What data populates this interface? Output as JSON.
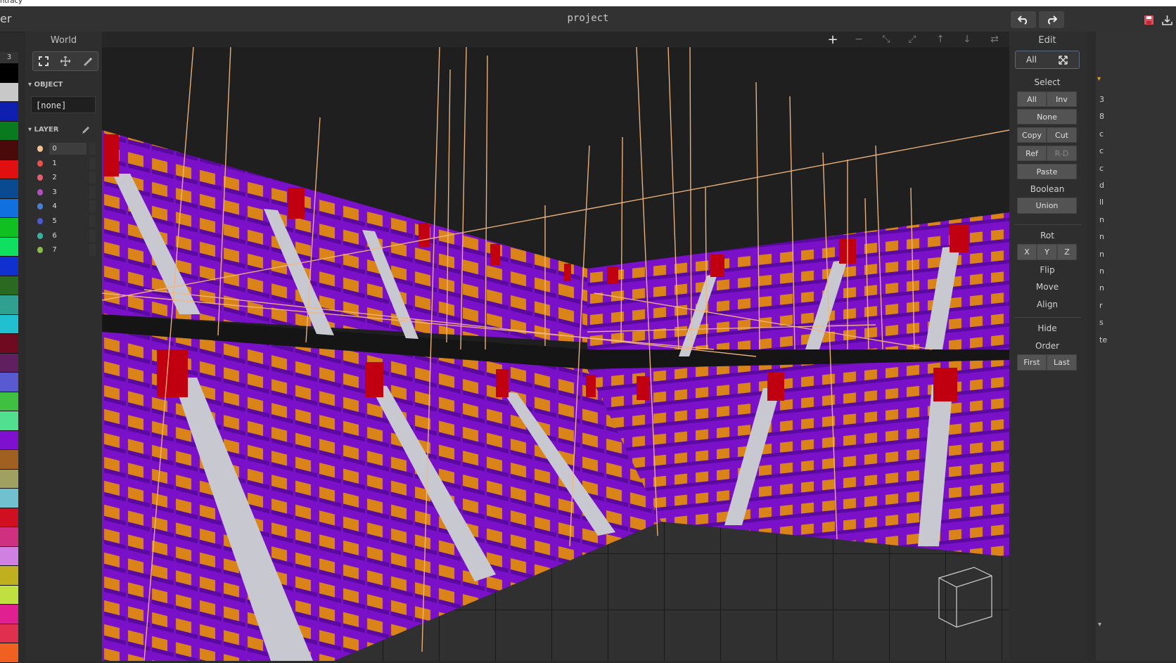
{
  "window": {
    "top_fragment": "ntracy",
    "left_fragment": "er",
    "title": "project"
  },
  "titlebar": {
    "undo_icon": "undo-icon",
    "redo_icon": "redo-icon",
    "save_icon": "save-icon",
    "export_icon": "export-icon"
  },
  "palette": {
    "index": "3",
    "colors": [
      "#000000",
      "#c8c8c8",
      "#0f1fb0",
      "#0a7a1e",
      "#4a0a0a",
      "#e01010",
      "#0a4a90",
      "#1070e0",
      "#10c020",
      "#10e060",
      "#1030d0",
      "#2a6a20",
      "#30a090",
      "#20c0d0",
      "#700a20",
      "#602060",
      "#5a5ad0",
      "#40c040",
      "#50e090",
      "#8010d0",
      "#a06020",
      "#a0a060",
      "#70c0d0",
      "#d01020",
      "#d03080",
      "#d080e0",
      "#c0b020",
      "#c0e040",
      "#e02090",
      "#e03050",
      "#f06020"
    ]
  },
  "left_panel": {
    "header": "World",
    "tools": {
      "select": "select-frame-icon",
      "move": "move-icon",
      "paint": "paint-icon"
    },
    "object_section": "OBJECT",
    "object_value": "[none]",
    "layer_section": "LAYER",
    "layers": [
      {
        "label": "0",
        "color": "#f3c18f"
      },
      {
        "label": "1",
        "color": "#e8504a"
      },
      {
        "label": "2",
        "color": "#e06070"
      },
      {
        "label": "3",
        "color": "#b050c0"
      },
      {
        "label": "4",
        "color": "#4a7fd0"
      },
      {
        "label": "5",
        "color": "#4a5ad0"
      },
      {
        "label": "6",
        "color": "#3ab0a0"
      },
      {
        "label": "7",
        "color": "#8cba4a"
      }
    ]
  },
  "viewport": {
    "toolbar": [
      "+",
      "−",
      "⤡",
      "⤢",
      "↑",
      "↓",
      "⇄"
    ]
  },
  "right_panel": {
    "header": "Edit",
    "all_label": "All",
    "select_heading": "Select",
    "select_all": "All",
    "select_inv": "Inv",
    "select_none": "None",
    "copy": "Copy",
    "cut": "Cut",
    "ref": "Ref",
    "rd": "R-D",
    "paste": "Paste",
    "boolean_heading": "Boolean",
    "union": "Union",
    "rot_heading": "Rot",
    "rot_x": "X",
    "rot_y": "Y",
    "rot_z": "Z",
    "flip": "Flip",
    "move": "Move",
    "align": "Align",
    "hide": "Hide",
    "order_heading": "Order",
    "first": "First",
    "last": "Last"
  },
  "far_right": {
    "chars": [
      "3",
      "8",
      "c",
      "c",
      "c",
      "d",
      "ll",
      "n",
      "n",
      "n",
      "n",
      "n",
      "r",
      "s",
      "te"
    ]
  }
}
